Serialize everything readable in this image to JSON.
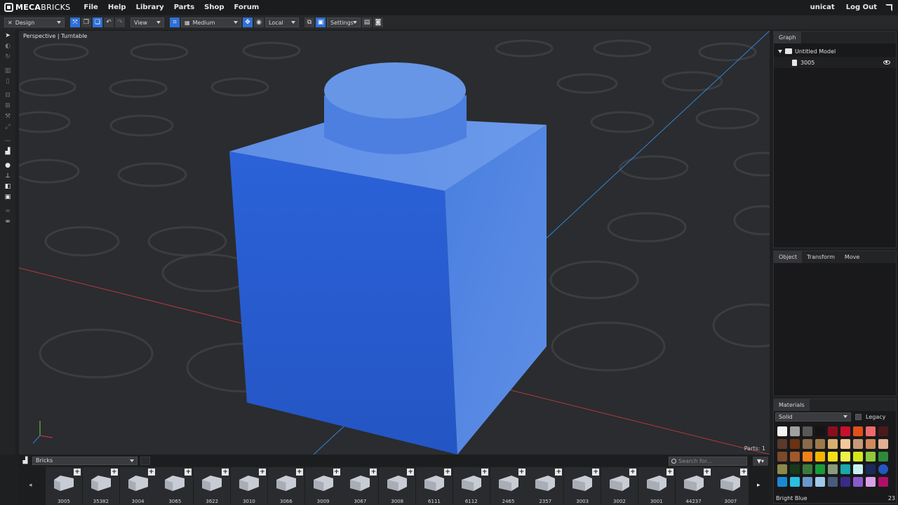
{
  "app": {
    "brand_bold": "MECA",
    "brand_rest": "BRICKS"
  },
  "menu": [
    "File",
    "Help",
    "Library",
    "Parts",
    "Shop",
    "Forum"
  ],
  "user": {
    "name": "unicat",
    "logout": "Log Out"
  },
  "toolbar": {
    "mode": "Design",
    "view": "View",
    "quality": "Medium",
    "space": "Local",
    "settings": "Settings"
  },
  "viewport": {
    "label": "Perspective | Turntable",
    "parts_count": "Parts: 1"
  },
  "graph": {
    "tab": "Graph",
    "root": "Untitled Model",
    "child": "3005"
  },
  "object_tabs": [
    "Object",
    "Transform",
    "Move"
  ],
  "materials": {
    "tab": "Materials",
    "type": "Solid",
    "legacy_label": "Legacy",
    "selected_name": "Bright Blue",
    "selected_id": "23",
    "swatches": [
      "#f4f4f4",
      "#a0a0a0",
      "#585858",
      "#141414",
      "#8a0f1e",
      "#c8102e",
      "#e1501a",
      "#f0696a",
      "#4a1a1a",
      "#5a3a2a",
      "#6b3213",
      "#8a6a4a",
      "#9e7a4a",
      "#d8b070",
      "#f4c89a",
      "#c89a78",
      "#d08a5a",
      "#e0b090",
      "#7a4a2a",
      "#a0582a",
      "#f0801a",
      "#f4b400",
      "#f4dc1a",
      "#f0f04a",
      "#d4e81a",
      "#8ec83c",
      "#2e8a3a",
      "#8a8a4a",
      "#17381a",
      "#3c7a3a",
      "#1a9a3a",
      "#8a9a7a",
      "#1aa8a8",
      "#c8f0f0",
      "#1a2a5a",
      "#2357c6",
      "#1a8ad0",
      "#2ac0e0",
      "#6a98c8",
      "#a0c8e8",
      "#4a5a7a",
      "#3a2a8a",
      "#8a5ac8",
      "#d8a0e8",
      "#b0106a"
    ]
  },
  "bottom": {
    "category": "Bricks",
    "search_placeholder": "Search for...",
    "parts": [
      "3005",
      "35382",
      "3004",
      "3065",
      "3622",
      "3010",
      "3066",
      "3009",
      "3067",
      "3008",
      "6111",
      "6112",
      "2465",
      "2357",
      "3003",
      "3002",
      "3001",
      "44237",
      "3007"
    ]
  }
}
